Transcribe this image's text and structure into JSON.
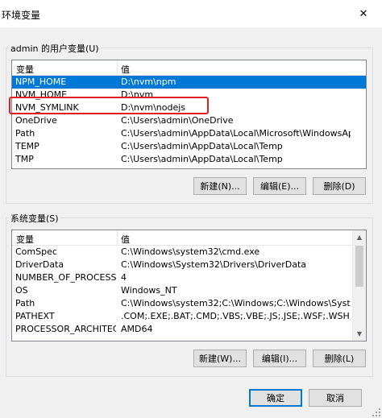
{
  "window": {
    "title": "环境变量",
    "close_glyph": "✕"
  },
  "user_vars": {
    "group_label": "admin 的用户变量(U)",
    "columns": [
      "变量",
      "值"
    ],
    "rows": [
      {
        "name": "NPM_HOME",
        "value": "D:\\nvm\\npm",
        "selected": true
      },
      {
        "name": "NVM_HOME",
        "value": "D:\\nvm",
        "selected": false
      },
      {
        "name": "NVM_SYMLINK",
        "value": "D:\\nvm\\nodejs",
        "selected": false,
        "highlighted": true
      },
      {
        "name": "OneDrive",
        "value": "C:\\Users\\admin\\OneDrive",
        "selected": false
      },
      {
        "name": "Path",
        "value": "C:\\Users\\admin\\AppData\\Local\\Microsoft\\WindowsApps;D:\\...",
        "selected": false
      },
      {
        "name": "TEMP",
        "value": "C:\\Users\\admin\\AppData\\Local\\Temp",
        "selected": false
      },
      {
        "name": "TMP",
        "value": "C:\\Users\\admin\\AppData\\Local\\Temp",
        "selected": false
      }
    ],
    "buttons": {
      "new": "新建(N)...",
      "edit": "编辑(E)...",
      "delete": "删除(D)"
    }
  },
  "system_vars": {
    "group_label": "系统变量(S)",
    "columns": [
      "变量",
      "值"
    ],
    "rows": [
      {
        "name": "ComSpec",
        "value": "C:\\Windows\\system32\\cmd.exe"
      },
      {
        "name": "DriverData",
        "value": "C:\\Windows\\System32\\Drivers\\DriverData"
      },
      {
        "name": "NUMBER_OF_PROCESSORS",
        "value": "4"
      },
      {
        "name": "OS",
        "value": "Windows_NT"
      },
      {
        "name": "Path",
        "value": "C:\\Windows\\system32;C:\\Windows;C:\\Windows\\System32\\Wb..."
      },
      {
        "name": "PATHEXT",
        "value": ".COM;.EXE;.BAT;.CMD;.VBS;.VBE;.JS;.JSE;.WSF;.WSH;.MSC"
      },
      {
        "name": "PROCESSOR_ARCHITECT...",
        "value": "AMD64"
      }
    ],
    "buttons": {
      "new": "新建(W)...",
      "edit": "编辑(I)...",
      "delete": "删除(L)"
    }
  },
  "footer": {
    "ok": "确定",
    "cancel": "取消"
  },
  "colors": {
    "selection": "#0078d7",
    "highlight_box": "#e02020"
  }
}
